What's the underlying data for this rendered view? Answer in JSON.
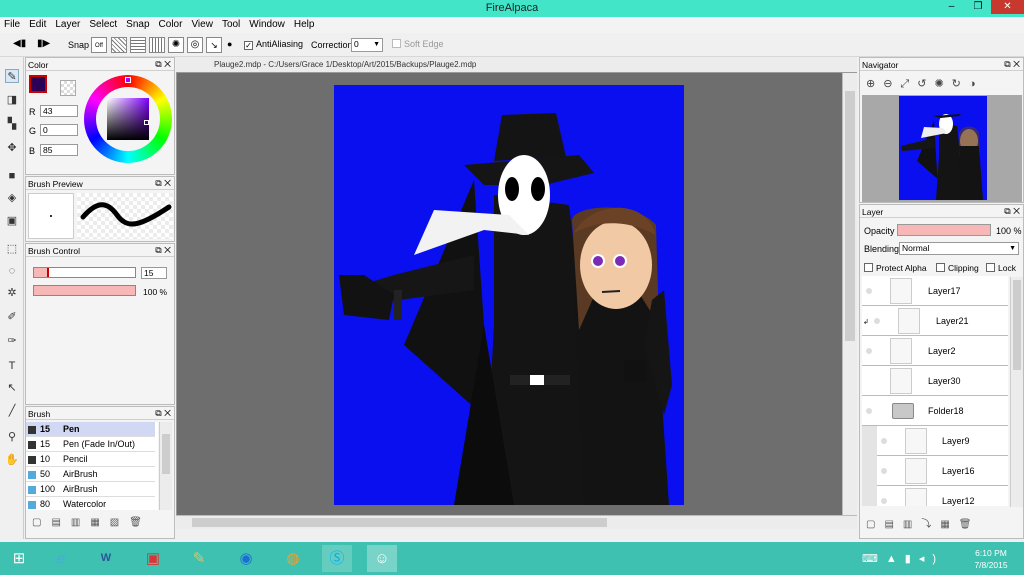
{
  "window": {
    "title": "FireAlpaca"
  },
  "menu": [
    "File",
    "Edit",
    "Layer",
    "Select",
    "Snap",
    "Color",
    "View",
    "Tool",
    "Window",
    "Help"
  ],
  "toolbar": {
    "snap": "Snap",
    "snap_off": "Off",
    "antialiasing": "AntiAliasing",
    "correction": "Correction",
    "correction_value": "0",
    "soft_edge": "Soft Edge"
  },
  "color": {
    "title": "Color",
    "r_label": "R",
    "g_label": "G",
    "b_label": "B",
    "r": "43",
    "g": "0",
    "b": "85",
    "fg": "#2b0055",
    "bg": "#ffffff"
  },
  "brush_preview": {
    "title": "Brush Preview"
  },
  "brush_control": {
    "title": "Brush Control",
    "size": "15",
    "opacity": "100 %",
    "size_fraction": 0.15,
    "opacity_fraction": 1.0
  },
  "brush": {
    "title": "Brush",
    "items": [
      {
        "size": "15",
        "name": "Pen",
        "selected": true
      },
      {
        "size": "15",
        "name": "Pen (Fade In/Out)"
      },
      {
        "size": "10",
        "name": "Pencil"
      },
      {
        "size": "50",
        "name": "AirBrush"
      },
      {
        "size": "100",
        "name": "AirBrush"
      },
      {
        "size": "80",
        "name": "Watercolor"
      }
    ]
  },
  "document": {
    "tab": "Plauge2.mdp - C:/Users/Grace 1/Desktop/Art/2015/Backups/Plauge2.mdp",
    "canvas_bg": "#0a0ff0"
  },
  "navigator": {
    "title": "Navigator"
  },
  "layer": {
    "title": "Layer",
    "opacity_label": "Opacity",
    "opacity": "100 %",
    "blending_label": "Blending",
    "blending": "Normal",
    "protect_alpha": "Protect Alpha",
    "clipping": "Clipping",
    "lock": "Lock",
    "items": [
      {
        "name": "Layer17",
        "indent": 0
      },
      {
        "name": "Layer21",
        "indent": 1
      },
      {
        "name": "Layer2",
        "indent": 0
      },
      {
        "name": "Layer30",
        "indent": 0
      },
      {
        "name": "Folder18",
        "indent": 0,
        "folder": true
      },
      {
        "name": "Layer9",
        "indent": 2
      },
      {
        "name": "Layer16",
        "indent": 2
      },
      {
        "name": "Layer12",
        "indent": 2
      }
    ]
  },
  "taskbar": {
    "time": "6:10 PM",
    "date": "7/8/2015"
  }
}
